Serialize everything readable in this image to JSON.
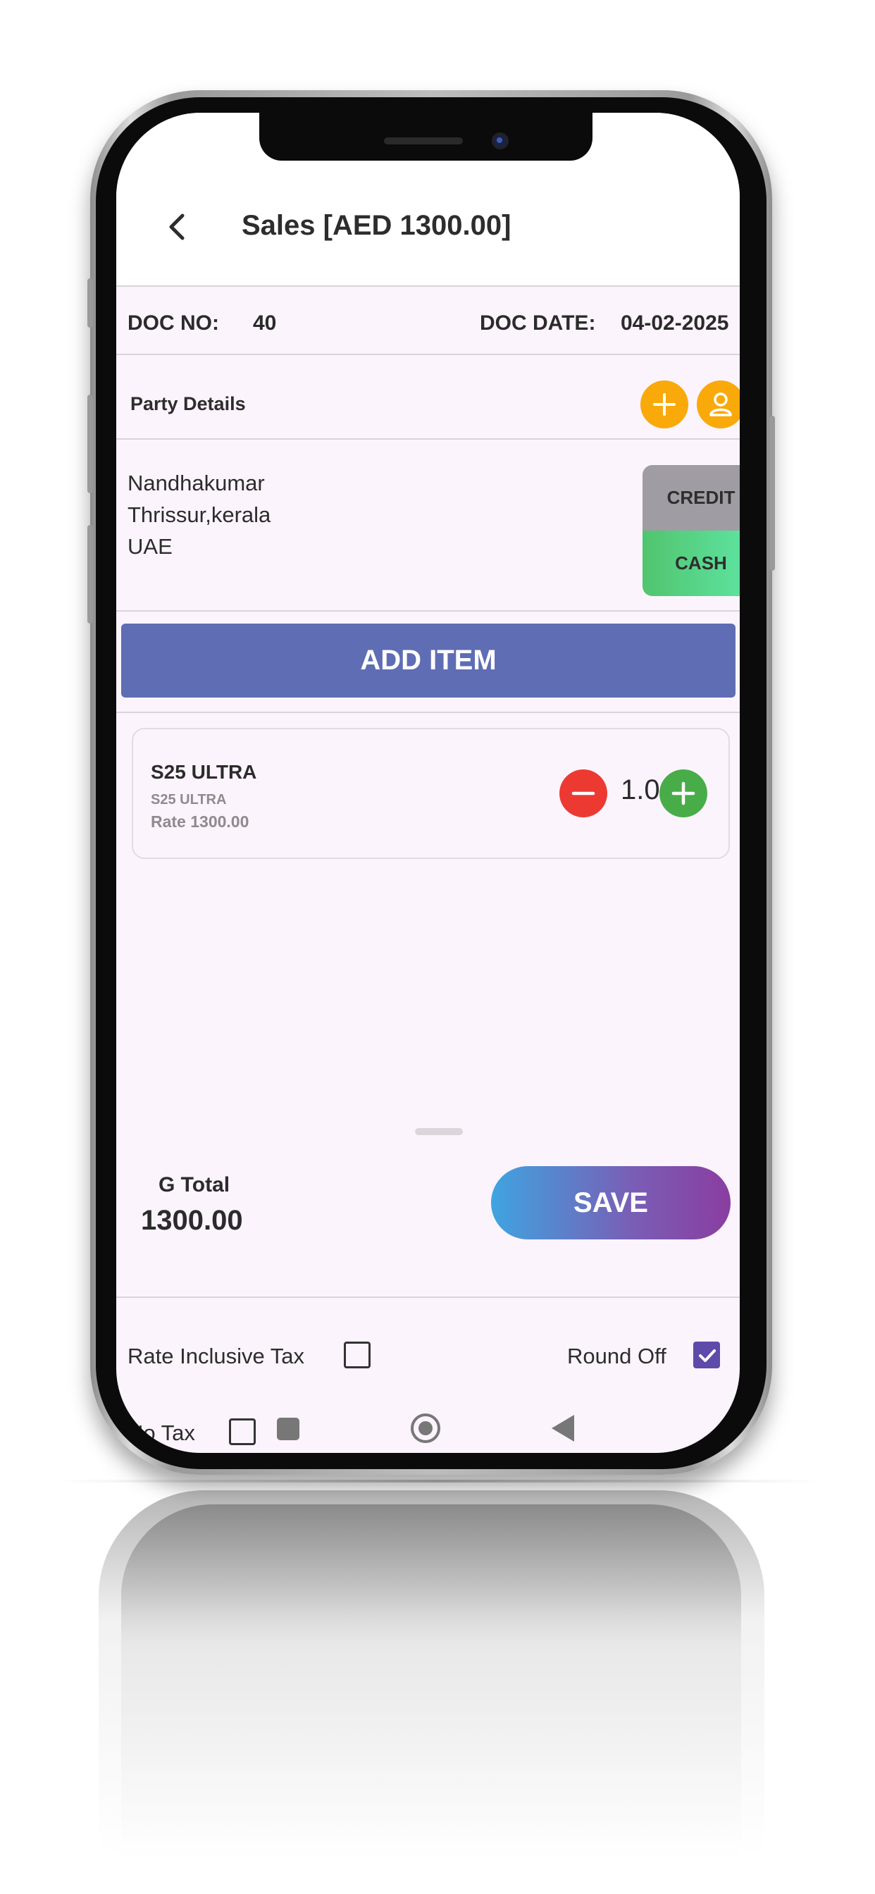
{
  "header": {
    "title": "Sales [AED 1300.00]"
  },
  "doc": {
    "no_label": "DOC NO:",
    "no_value": "40",
    "date_label": "DOC DATE:",
    "date_value": "04-02-2025"
  },
  "party": {
    "label": "Party Details",
    "name": "Nandhakumar",
    "address": "Thrissur,kerala",
    "country": "UAE"
  },
  "payment": {
    "credit_label": "CREDIT",
    "cash_label": "CASH",
    "selected": "CASH"
  },
  "add_item_label": "ADD ITEM",
  "items": [
    {
      "name": "S25 ULTRA",
      "description": "S25 ULTRA",
      "rate_text": "Rate 1300.00",
      "qty": "1.0"
    }
  ],
  "totals": {
    "label": "G Total",
    "value": "1300.00"
  },
  "save_label": "SAVE",
  "options": {
    "rate_inclusive_tax": {
      "label": "Rate Inclusive Tax",
      "checked": false
    },
    "round_off": {
      "label": "Round Off",
      "checked": true
    },
    "no_tax": {
      "label": "No Tax",
      "checked": false
    }
  },
  "colors": {
    "accent": "#5f6db5",
    "orange": "#f9a90a",
    "minus": "#ec3a33",
    "plus": "#48ad49",
    "check": "#5e4aa8"
  }
}
